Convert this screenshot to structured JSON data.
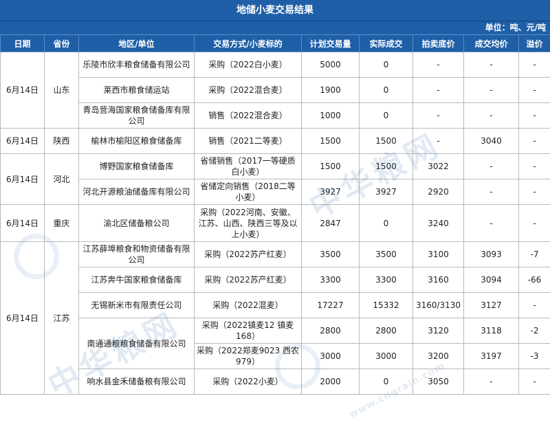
{
  "title": "地储小麦交易结果",
  "unit": "单位：吨、元/吨",
  "headers": [
    "日期",
    "省份",
    "地区/单位",
    "交易方式/小麦标的",
    "计划交易量",
    "实际成交",
    "拍卖底价",
    "成交均价",
    "溢价"
  ],
  "groups": [
    {
      "date": "6月14日",
      "province": "山东",
      "rows": [
        {
          "unit": "乐陵市欣丰粮食储备有限公司",
          "method": "采购（2022白小麦）",
          "plan": "5000",
          "actual": "0",
          "floor": "-",
          "avg": "-",
          "premium": "-"
        },
        {
          "unit": "莱西市粮食储运站",
          "method": "采购（2022混合麦）",
          "plan": "1900",
          "actual": "0",
          "floor": "-",
          "avg": "-",
          "premium": "-"
        },
        {
          "unit": "青岛营海国家粮食储备库有限公司",
          "method": "销售（2022混合麦）",
          "plan": "1000",
          "actual": "0",
          "floor": "-",
          "avg": "-",
          "premium": "-"
        }
      ]
    },
    {
      "date": "6月14日",
      "province": "陕西",
      "rows": [
        {
          "unit": "榆林市榆阳区粮食储备库",
          "method": "销售（2021二等麦）",
          "plan": "1500",
          "actual": "1500",
          "floor": "-",
          "avg": "3040",
          "premium": "-"
        }
      ]
    },
    {
      "date": "6月14日",
      "province": "河北",
      "rows": [
        {
          "unit": "博野国家粮食储备库",
          "method": "省储销售（2017一等硬质白小麦）",
          "plan": "1500",
          "actual": "1500",
          "floor": "3022",
          "avg": "-",
          "premium": "-"
        },
        {
          "unit": "河北开源粮油储备库有限公司",
          "method": "省储定向销售（2018二等小麦）",
          "plan": "3927",
          "actual": "3927",
          "floor": "2920",
          "avg": "-",
          "premium": "-"
        }
      ]
    },
    {
      "date": "6月14日",
      "province": "重庆",
      "rows": [
        {
          "unit": "渝北区储备粮公司",
          "method": "采购（2022河南、安徽、江苏、山西、陕西三等及以上小麦）",
          "plan": "2847",
          "actual": "0",
          "floor": "3240",
          "avg": "-",
          "premium": "-"
        }
      ]
    },
    {
      "date": "6月14日",
      "province": "江苏",
      "rows": [
        {
          "unit": "江苏薛埠粮食和物资储备有限公司",
          "method": "采购（2022苏产红麦）",
          "plan": "3500",
          "actual": "3500",
          "floor": "3100",
          "avg": "3093",
          "premium": "-7"
        },
        {
          "unit": "江苏奔牛国家粮食储备库",
          "method": "采购（2022苏产红麦）",
          "plan": "3300",
          "actual": "3300",
          "floor": "3160",
          "avg": "3094",
          "premium": "-66"
        },
        {
          "unit": "无锡新米市有限责任公司",
          "method": "采购（2022混麦）",
          "plan": "17227",
          "actual": "15332",
          "floor": "3160/3130",
          "avg": "3127",
          "premium": "-"
        },
        {
          "unit": "南通通粮粮食储备有限公司",
          "method": "采购（2022镇麦12 镇麦168）",
          "plan": "2800",
          "actual": "2800",
          "floor": "3120",
          "avg": "3118",
          "premium": "-2"
        },
        {
          "unit": "",
          "method": "采购（2022郑麦9023 西农979）",
          "plan": "3000",
          "actual": "3000",
          "floor": "3200",
          "avg": "3197",
          "premium": "-3"
        },
        {
          "unit": "响水县金禾储备粮有限公司",
          "method": "采购（2022小麦）",
          "plan": "2000",
          "actual": "0",
          "floor": "3050",
          "avg": "-",
          "premium": "-"
        }
      ]
    }
  ],
  "watermark": {
    "text": "中华粮网",
    "url": "www.cngrain.com"
  }
}
